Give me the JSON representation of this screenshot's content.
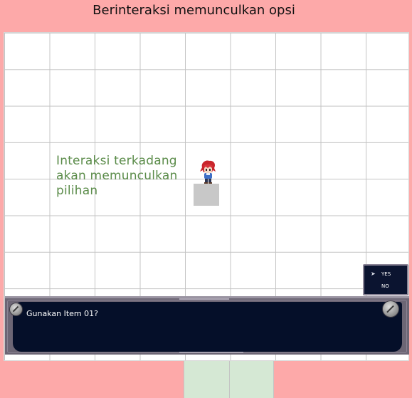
{
  "page": {
    "heading": "Berinteraksi memunculkan opsi"
  },
  "scene": {
    "hint_lines": [
      "Interaksi terkadang",
      "akan memunculkan",
      "pilihan"
    ]
  },
  "dialog": {
    "message": "Gunakan Item 01?"
  },
  "choices": {
    "options": [
      "YES",
      "NO"
    ],
    "selected": "YES"
  },
  "colors": {
    "background": "#fda9a9",
    "hint_text": "#5b8c4a",
    "dialog_bg": "#050f29",
    "dialog_frame": "#6d6675",
    "green_tile": "#d5e8d4"
  },
  "icons": {
    "choice_cursor": "cursor-arrow-icon",
    "screw_left": "screw-icon",
    "screw_right": "screw-icon"
  }
}
